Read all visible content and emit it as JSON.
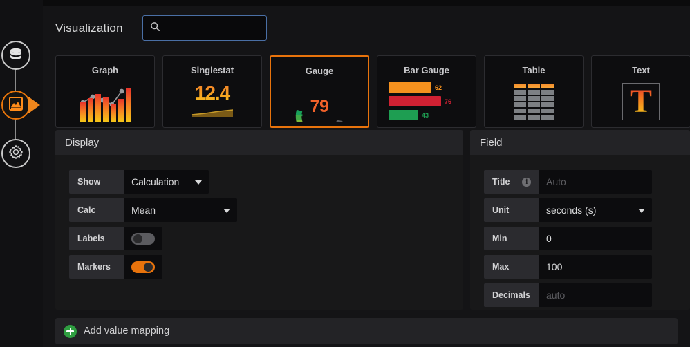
{
  "sidebar": {
    "items": [
      {
        "name": "datasource",
        "icon": "database-icon",
        "active": false
      },
      {
        "name": "visualization",
        "icon": "chart-area-icon",
        "active": true
      },
      {
        "name": "general-settings",
        "icon": "gear-wrench-icon",
        "active": false
      }
    ]
  },
  "header": {
    "title": "Visualization",
    "search": {
      "value": "",
      "placeholder": "",
      "icon": "search-icon"
    }
  },
  "viz_types": [
    {
      "label": "Graph",
      "selected": false,
      "art": "bars-with-line",
      "bars": [
        28,
        34,
        40,
        36,
        26,
        33,
        48
      ]
    },
    {
      "label": "Singlestat",
      "selected": false,
      "art": "big-number-sparkline",
      "value": "12.4"
    },
    {
      "label": "Gauge",
      "selected": true,
      "art": "radial-gauge",
      "value": "79",
      "segments": 14,
      "filled_segments": 11
    },
    {
      "label": "Bar Gauge",
      "selected": false,
      "art": "horizontal-bars",
      "rows": [
        {
          "value": "62",
          "width": 62,
          "color": "#f5911e"
        },
        {
          "value": "76",
          "width": 76,
          "color": "#d02133"
        },
        {
          "value": "43",
          "width": 43,
          "color": "#1e9e52"
        }
      ]
    },
    {
      "label": "Table",
      "selected": false,
      "art": "grid-table"
    },
    {
      "label": "Text",
      "selected": false,
      "art": "letter-t"
    }
  ],
  "display_panel": {
    "title": "Display",
    "rows": [
      {
        "label": "Show",
        "type": "select",
        "value": "Calculation"
      },
      {
        "label": "Calc",
        "type": "select",
        "value": "Mean"
      },
      {
        "label": "Labels",
        "type": "toggle",
        "state": "off"
      },
      {
        "label": "Markers",
        "type": "toggle",
        "state": "on"
      }
    ]
  },
  "field_panel": {
    "title": "Field",
    "rows": [
      {
        "label": "Title",
        "type": "input",
        "value": "",
        "placeholder": "Auto",
        "info": true
      },
      {
        "label": "Unit",
        "type": "select",
        "value": "seconds (s)"
      },
      {
        "label": "Min",
        "type": "input",
        "value": "0",
        "placeholder": ""
      },
      {
        "label": "Max",
        "type": "input",
        "value": "100",
        "placeholder": ""
      },
      {
        "label": "Decimals",
        "type": "input",
        "value": "",
        "placeholder": "auto"
      }
    ]
  },
  "value_mapping": {
    "label": "Add value mapping",
    "icon": "plus-circle-icon"
  },
  "colors": {
    "accent": "#e8730c",
    "panel_header": "#232326",
    "panel_body": "#181819",
    "label_cell": "#2b2b2f",
    "input_cell": "#0c0c0e",
    "focus_border": "#4a6fa5",
    "annotation_red": "#f01e11",
    "green": "#2f9e41"
  }
}
